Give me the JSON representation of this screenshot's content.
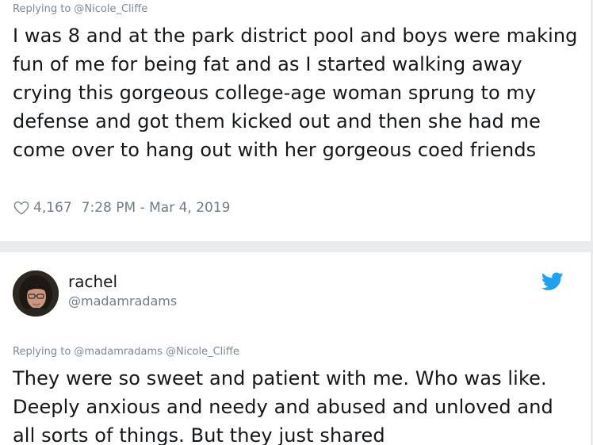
{
  "tweet_1": {
    "replying_to": "Replying to @Nicole_Cliffe",
    "text": "I was 8 and at the park district pool and boys were making fun of me for being fat and as I started walking away crying this gorgeous college-age woman sprung to my defense and got them kicked out and then she had me come over to hang out with her gorgeous coed friends",
    "likes": "4,167",
    "timestamp": "7:28 PM - Mar 4, 2019",
    "like_icon": "heart-outline-icon"
  },
  "tweet_2": {
    "user_name": "rachel",
    "user_handle": "@madamradams",
    "replying_to": "Replying to @madamradams @Nicole_Cliffe",
    "text": "They were so sweet and patient with me. Who was like. Deeply anxious and needy and abused and unloved and all sorts of things. But they just shared",
    "brand_icon": "twitter-bird-icon"
  },
  "colors": {
    "twitter_blue": "#1da1f2",
    "text_primary": "#14171a",
    "text_secondary": "#6e7d8a",
    "separator": "#e9ebed"
  }
}
